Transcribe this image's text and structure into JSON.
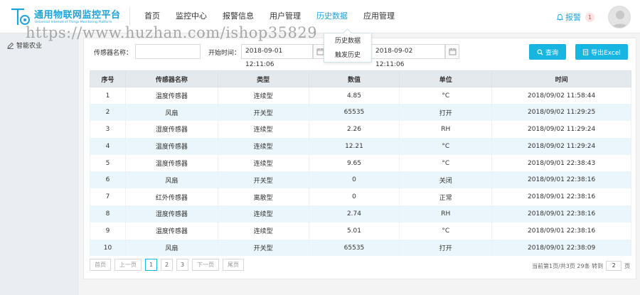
{
  "header": {
    "title": "通用物联网监控平台",
    "subtitle": "Universal Internet of Things Monitoring Platform",
    "nav": [
      {
        "label": "首页",
        "name": "nav-home"
      },
      {
        "label": "监控中心",
        "name": "nav-monitor"
      },
      {
        "label": "报警信息",
        "name": "nav-alarm-info"
      },
      {
        "label": "用户管理",
        "name": "nav-user-mgmt"
      },
      {
        "label": "历史数据",
        "name": "nav-history"
      },
      {
        "label": "应用管理",
        "name": "nav-app-mgmt"
      }
    ],
    "alarm_label": "报警",
    "alarm_count": "1",
    "accent": "#1ea3d8"
  },
  "dropdown": {
    "items": [
      "历史数据",
      "触发历史"
    ]
  },
  "sidebar": {
    "items": [
      {
        "label": "智能农业",
        "icon": "edit-icon"
      }
    ]
  },
  "toolbar": {
    "sensor_label": "传感器名称：",
    "sensor_value": "",
    "start_label": "开始时间：",
    "start_value": "2018-09-01 12:11:06",
    "end_value": "2018-09-02 12:11:06",
    "query_label": "查询",
    "export_label": "导出Excel"
  },
  "table": {
    "headers": [
      "序号",
      "传感器名称",
      "类型",
      "数值",
      "单位",
      "时间"
    ],
    "rows": [
      [
        "1",
        "温度传感器",
        "连续型",
        "4.85",
        "°C",
        "2018/09/02 11:58:44"
      ],
      [
        "2",
        "风扇",
        "开关型",
        "65535",
        "打开",
        "2018/09/02 11:29:25"
      ],
      [
        "3",
        "湿度传感器",
        "连续型",
        "2.26",
        "RH",
        "2018/09/02 11:29:24"
      ],
      [
        "4",
        "温度传感器",
        "连续型",
        "12.21",
        "°C",
        "2018/09/02 11:29:24"
      ],
      [
        "5",
        "温度传感器",
        "连续型",
        "9.65",
        "°C",
        "2018/09/01 22:38:43"
      ],
      [
        "6",
        "风扇",
        "开关型",
        "0",
        "关闭",
        "2018/09/01 22:38:16"
      ],
      [
        "7",
        "红外传感器",
        "离散型",
        "0",
        "正常",
        "2018/09/01 22:38:16"
      ],
      [
        "8",
        "湿度传感器",
        "连续型",
        "2.74",
        "RH",
        "2018/09/01 22:38:16"
      ],
      [
        "9",
        "温度传感器",
        "连续型",
        "5.01",
        "°C",
        "2018/09/01 22:38:16"
      ],
      [
        "10",
        "风扇",
        "开关型",
        "65535",
        "打开",
        "2018/09/01 22:38:09"
      ]
    ]
  },
  "pager": {
    "first": "首页",
    "prev": "上一页",
    "pages": [
      "1",
      "2",
      "3"
    ],
    "current": "1",
    "next": "下一页",
    "last": "尾页",
    "info": "当前第1页/共3页 29条 转到",
    "jump_value": "2",
    "jump_suffix": "页"
  },
  "watermark": "https://www.huzhan.com/ishop35829"
}
